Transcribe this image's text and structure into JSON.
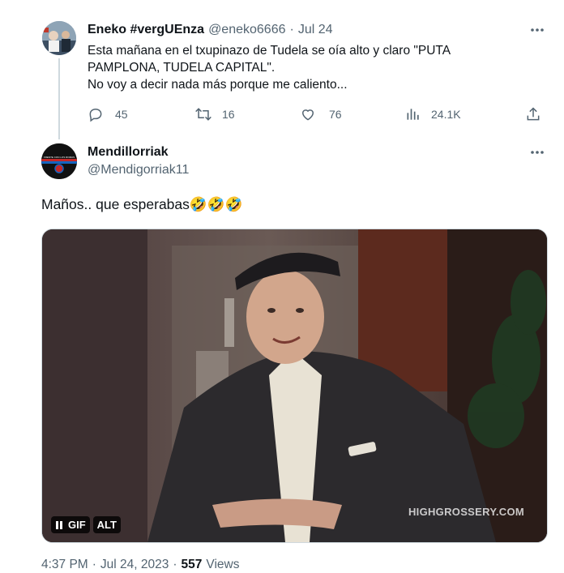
{
  "tweet1": {
    "name": "Eneko #vergUEnza",
    "handle": "@eneko6666",
    "separator": "·",
    "date": "Jul 24",
    "lines": [
      "Esta mañana en el txupinazo de Tudela se oía alto y claro \"PUTA",
      "PAMPLONA,  TUDELA CAPITAL\".",
      "No voy a decir nada más porque me caliento..."
    ],
    "stats": {
      "replies": "45",
      "retweets": "16",
      "likes": "76",
      "views": "24.1K"
    }
  },
  "tweet2": {
    "name": "Mendillorriak",
    "handle": "@Mendigorriak11",
    "text": "Maños.. que esperabas🤣🤣🤣",
    "media": {
      "watermark": "HIGHGROSSERY.COM",
      "gif_label": "GIF",
      "alt_label": "ALT",
      "avatar_text": "FRENTE CON LOS ROMAS"
    },
    "footer": {
      "time": "4:37 PM",
      "separator": "·",
      "date": "Jul 24, 2023",
      "separator2": "·",
      "views_count": "557",
      "views_label": "Views"
    }
  },
  "colors": {
    "text": "#0f1419",
    "muted": "#536471",
    "thread_line": "#cfd9de",
    "background": "#ffffff"
  },
  "icons": [
    "more-icon",
    "reply-icon",
    "retweet-icon",
    "like-icon",
    "views-icon",
    "share-icon",
    "pause-icon"
  ]
}
